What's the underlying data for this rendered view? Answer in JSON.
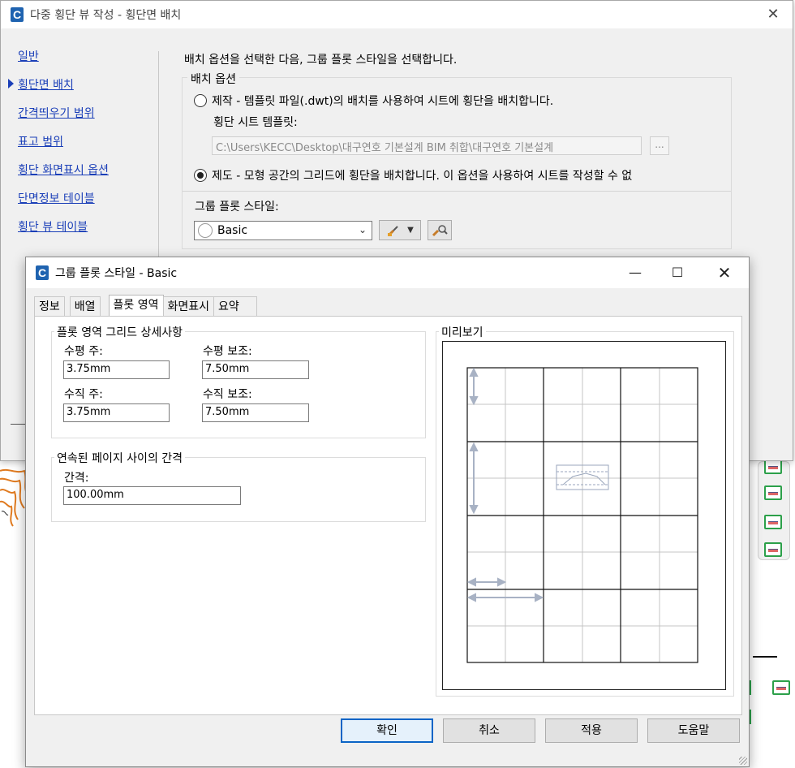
{
  "main_dialog": {
    "title": "다중 횡단 뷰 작성 - 횡단면 배치",
    "nav": {
      "items": [
        {
          "label": "일반",
          "active": false
        },
        {
          "label": "횡단면 배치",
          "active": true
        },
        {
          "label": "간격띄우기 범위",
          "active": false
        },
        {
          "label": "표고 범위",
          "active": false
        },
        {
          "label": "횡단 화면표시 옵션",
          "active": false
        },
        {
          "label": "단면정보 테이블",
          "active": false
        },
        {
          "label": "횡단 뷰 테이블",
          "active": false
        }
      ]
    },
    "instruction": "배치 옵션을 선택한 다음, 그룹 플롯 스타일을 선택합니다.",
    "placement_options": {
      "legend": "배치 옵션",
      "option_production": "제작 - 템플릿 파일(.dwt)의 배치를 사용하여 시트에 횡단을 배치합니다.",
      "template_label": "횡단 시트 템플릿:",
      "template_path": "C:\\Users\\KECC\\Desktop\\대구연호 기본설계 BIM 취합\\대구연호 기본설계",
      "browse_label": "...",
      "option_draft": "제도 - 모형 공간의 그리드에 횡단을 배치합니다. 이 옵션을 사용하여 시트를 작성할 수 없",
      "selected_option": "draft"
    },
    "group_plot_style": {
      "label": "그룹 플롯 스타일:",
      "selected": "Basic"
    }
  },
  "style_dialog": {
    "title": "그룹 플롯 스타일 - Basic",
    "tabs": [
      "정보",
      "배열",
      "플롯 영역",
      "화면표시",
      "요약"
    ],
    "active_tab": "플롯 영역",
    "grid_details": {
      "legend": "플롯 영역 그리드 상세사항",
      "horizontal_major_label": "수평 주:",
      "horizontal_major_value": "3.75mm",
      "horizontal_minor_label": "수평 보조:",
      "horizontal_minor_value": "7.50mm",
      "vertical_major_label": "수직 주:",
      "vertical_major_value": "3.75mm",
      "vertical_minor_label": "수직 보조:",
      "vertical_minor_value": "7.50mm"
    },
    "page_spacing": {
      "legend": "연속된 페이지 사이의 간격",
      "spacing_label": "간격:",
      "spacing_value": "100.00mm"
    },
    "preview_legend": "미리보기",
    "buttons": {
      "ok": "확인",
      "cancel": "취소",
      "apply": "적용",
      "help": "도움말"
    }
  },
  "colors": {
    "link": "#1b3fb8",
    "accent_border": "#0a64c6",
    "app_icon": "#1f63b0",
    "preview_arrow": "#aab4c8"
  }
}
